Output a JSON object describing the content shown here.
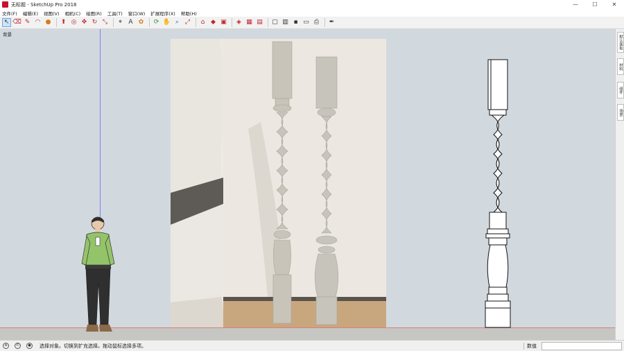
{
  "window": {
    "title": "无标题 - SketchUp Pro 2018",
    "controls": [
      "—",
      "☐",
      "✕"
    ]
  },
  "menu": [
    "文件(F)",
    "编辑(E)",
    "视图(V)",
    "相机(C)",
    "绘图(R)",
    "工具(T)",
    "窗口(W)",
    "扩展程序(X)",
    "帮助(H)"
  ],
  "toolbar": {
    "tools": [
      {
        "name": "select-icon",
        "glyph": "↖",
        "selected": true
      },
      {
        "name": "eraser-icon",
        "glyph": "⌫"
      },
      {
        "name": "line-icon",
        "glyph": "✎"
      },
      {
        "name": "arc-icon",
        "glyph": "◠"
      },
      {
        "name": "shape-icon",
        "glyph": "●"
      },
      {
        "name": "pushpull-icon",
        "glyph": "⬆"
      },
      {
        "name": "offset-icon",
        "glyph": "◎"
      },
      {
        "name": "move-icon",
        "glyph": "✥"
      },
      {
        "name": "rotate-icon",
        "glyph": "↻"
      },
      {
        "name": "scale-icon",
        "glyph": "⤡"
      },
      {
        "name": "tape-icon",
        "glyph": "⌖"
      },
      {
        "name": "text-icon",
        "glyph": "A"
      },
      {
        "name": "paint-icon",
        "glyph": "✿"
      },
      {
        "name": "orbit-icon",
        "glyph": "⟳"
      },
      {
        "name": "pan-icon",
        "glyph": "✋"
      },
      {
        "name": "zoom-icon",
        "glyph": "⌕"
      },
      {
        "name": "zoom-extents-icon",
        "glyph": "⤢"
      },
      {
        "name": "warehouse-icon",
        "glyph": "⌂"
      },
      {
        "name": "extension-warehouse-icon",
        "glyph": "◆"
      },
      {
        "name": "send-to-layout-icon",
        "glyph": "▣"
      },
      {
        "name": "ruby-icon",
        "glyph": "◈"
      },
      {
        "name": "photo-textures-icon",
        "glyph": "▦"
      },
      {
        "name": "generate-report-icon",
        "glyph": "▤"
      },
      {
        "name": "section-plane-icon",
        "glyph": "▢"
      },
      {
        "name": "display-section-icon",
        "glyph": "▥"
      },
      {
        "name": "display-cuts-icon",
        "glyph": "▪"
      },
      {
        "name": "section-fill-icon",
        "glyph": "▭"
      },
      {
        "name": "print-icon",
        "glyph": "⎙"
      },
      {
        "name": "dynamic-component-icon",
        "glyph": "✒"
      }
    ]
  },
  "scene": {
    "tab_label": "背景"
  },
  "right_panel": {
    "tabs": [
      "默认面板",
      "材料",
      "组件",
      "场景"
    ]
  },
  "status": {
    "message": "选择对象。切换到扩充选择。拖动鼠标选择多项。",
    "measure_label": "数值",
    "measure_value": ""
  }
}
